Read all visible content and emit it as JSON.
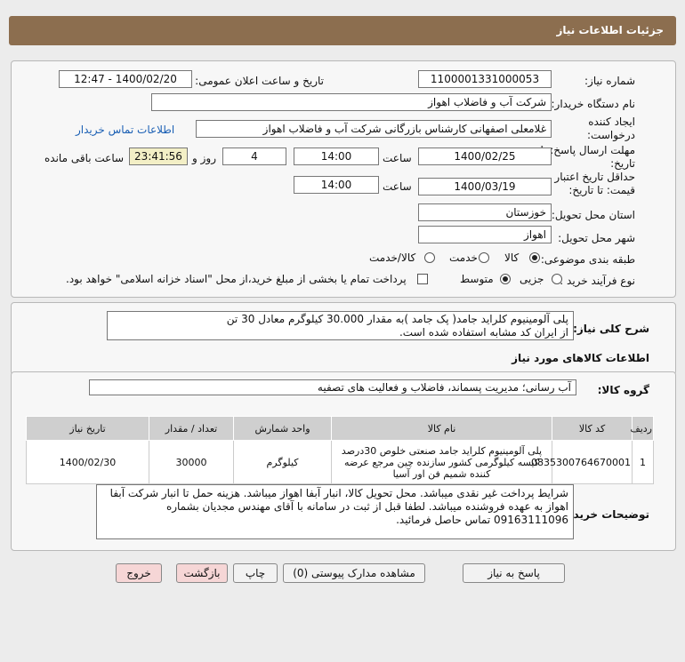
{
  "header": {
    "title": "جزئیات اطلاعات نیاز"
  },
  "fields": {
    "need_number_label": "شماره نیاز:",
    "need_number": "1100001331000053",
    "announce_label": "تاریخ و ساعت اعلان عمومی:",
    "announce_value": "1400/02/20 - 12:47",
    "buyer_org_label": "نام دستگاه خریدار:",
    "buyer_org": "شرکت آب و فاضلاب اهواز",
    "creator_label": "ایجاد کننده درخواست:",
    "creator": "غلامعلی اصفهانی کارشناس بازرگانی شرکت آب و فاضلاب اهواز",
    "contact_link": "اطلاعات تماس خریدار",
    "deadline_label": "مهلت ارسال پاسخ: تا تاریخ:",
    "deadline_date": "1400/02/25",
    "time_label": "ساعت",
    "deadline_time": "14:00",
    "days_value": "4",
    "days_label": "روز و",
    "remaining_time": "23:41:56",
    "remaining_label": "ساعت باقی مانده",
    "validity_label": "حداقل تاریخ اعتبار قیمت: تا تاریخ:",
    "validity_date": "1400/03/19",
    "validity_time": "14:00",
    "province_label": "استان محل تحویل:",
    "province": "خوزستان",
    "city_label": "شهر محل تحویل:",
    "city": "اهواز",
    "category_label": "طبقه بندی موضوعی:",
    "category_options": [
      "کالا",
      "خدمت",
      "کالا/خدمت"
    ],
    "process_label": "نوع فرآیند خرید :",
    "process_options": [
      "جزیی",
      "متوسط"
    ],
    "payment_note": "پرداخت تمام یا بخشی از مبلغ خرید،از محل \"اسناد خزانه اسلامی\" خواهد بود."
  },
  "summary": {
    "label": "شرح کلی نیاز:",
    "line1": "پلی آلومینیوم کلراید جامد( پک جامد )به مقدار 30.000 کیلوگرم معادل 30 تن",
    "line2": "از ایران کد مشابه استفاده شده است."
  },
  "goods": {
    "section_title": "اطلاعات کالاهای مورد نیاز",
    "group_label": "گروه کالا:",
    "group_value": "آب رسانی؛ مدیریت پسماند، فاضلاب و فعالیت های تصفیه",
    "columns": [
      "ردیف",
      "کد کالا",
      "نام کالا",
      "واحد شمارش",
      "تعداد / مقدار",
      "تاریخ نیاز"
    ],
    "rows": [
      {
        "row": "1",
        "code": "0835300764670001",
        "name": "پلی آلومینیوم کلراید جامد صنعتی خلوص 30درصد کیسه کیلوگرمی کشور سازنده چین مرجع عرضه کننده شمیم فن اور آسیا",
        "unit": "کیلوگرم",
        "qty": "30000",
        "date": "1400/02/30"
      }
    ]
  },
  "buyer_notes": {
    "label": "توضیحات خریدار:",
    "text": "شرایط پرداخت غیر نقدی میباشد. محل تحویل کالا، انبار آبفا اهواز میباشد. هزینه حمل تا انبار شرکت آبفا اهواز به عهده فروشنده میباشد. لطفا قبل از ثبت در سامانه با آقای مهندس مجدیان بشماره 09163111096 تماس حاصل فرمائید."
  },
  "buttons": {
    "reply": "پاسخ به نیاز",
    "attachments": "مشاهده مدارک پیوستی (0)",
    "print": "چاپ",
    "back": "بازگشت",
    "exit": "خروج"
  },
  "watermark": {
    "latin": "ParsNamadData",
    "persian": "پایگاه اطلاع رسانی مناقصات و مزایدات"
  }
}
